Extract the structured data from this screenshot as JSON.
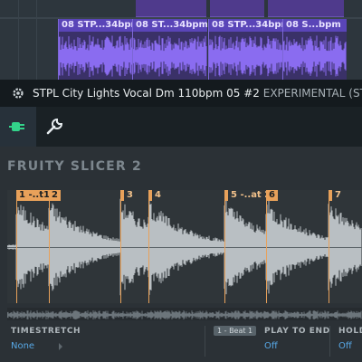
{
  "playlist": {
    "clips": [
      {
        "label": "08 STP...34bpm"
      },
      {
        "label": "08 ST...34bpm"
      },
      {
        "label": "08 STP...34bpm"
      },
      {
        "label": "08 S...bpm"
      }
    ]
  },
  "channel": {
    "title": "STPL City Lights Vocal Dm 110bpm 05 #2",
    "subtitle": "EXPERIMENTAL (STPL City Li"
  },
  "plugin": {
    "name": "FRUITY SLICER 2",
    "markers": [
      {
        "label": "1 -..t1"
      },
      {
        "label": "2"
      },
      {
        "label": "3"
      },
      {
        "label": "4"
      },
      {
        "label": "5 -..at 2"
      },
      {
        "label": "6"
      },
      {
        "label": "7"
      }
    ],
    "controls": {
      "timestretch_label": "TIMESTRETCH",
      "timestretch_value": "None",
      "beat_badge": "1 - Beat 1",
      "play_to_end_label": "PLAY TO END",
      "play_to_end_value": "Off",
      "hold_label": "HOLD",
      "hold_value": "Off"
    }
  },
  "colors": {
    "accent_marker": "#e8a15a",
    "clip_purple": "#5a45b8",
    "value_blue": "#57a8e6",
    "plug_green": "#33d38a"
  }
}
